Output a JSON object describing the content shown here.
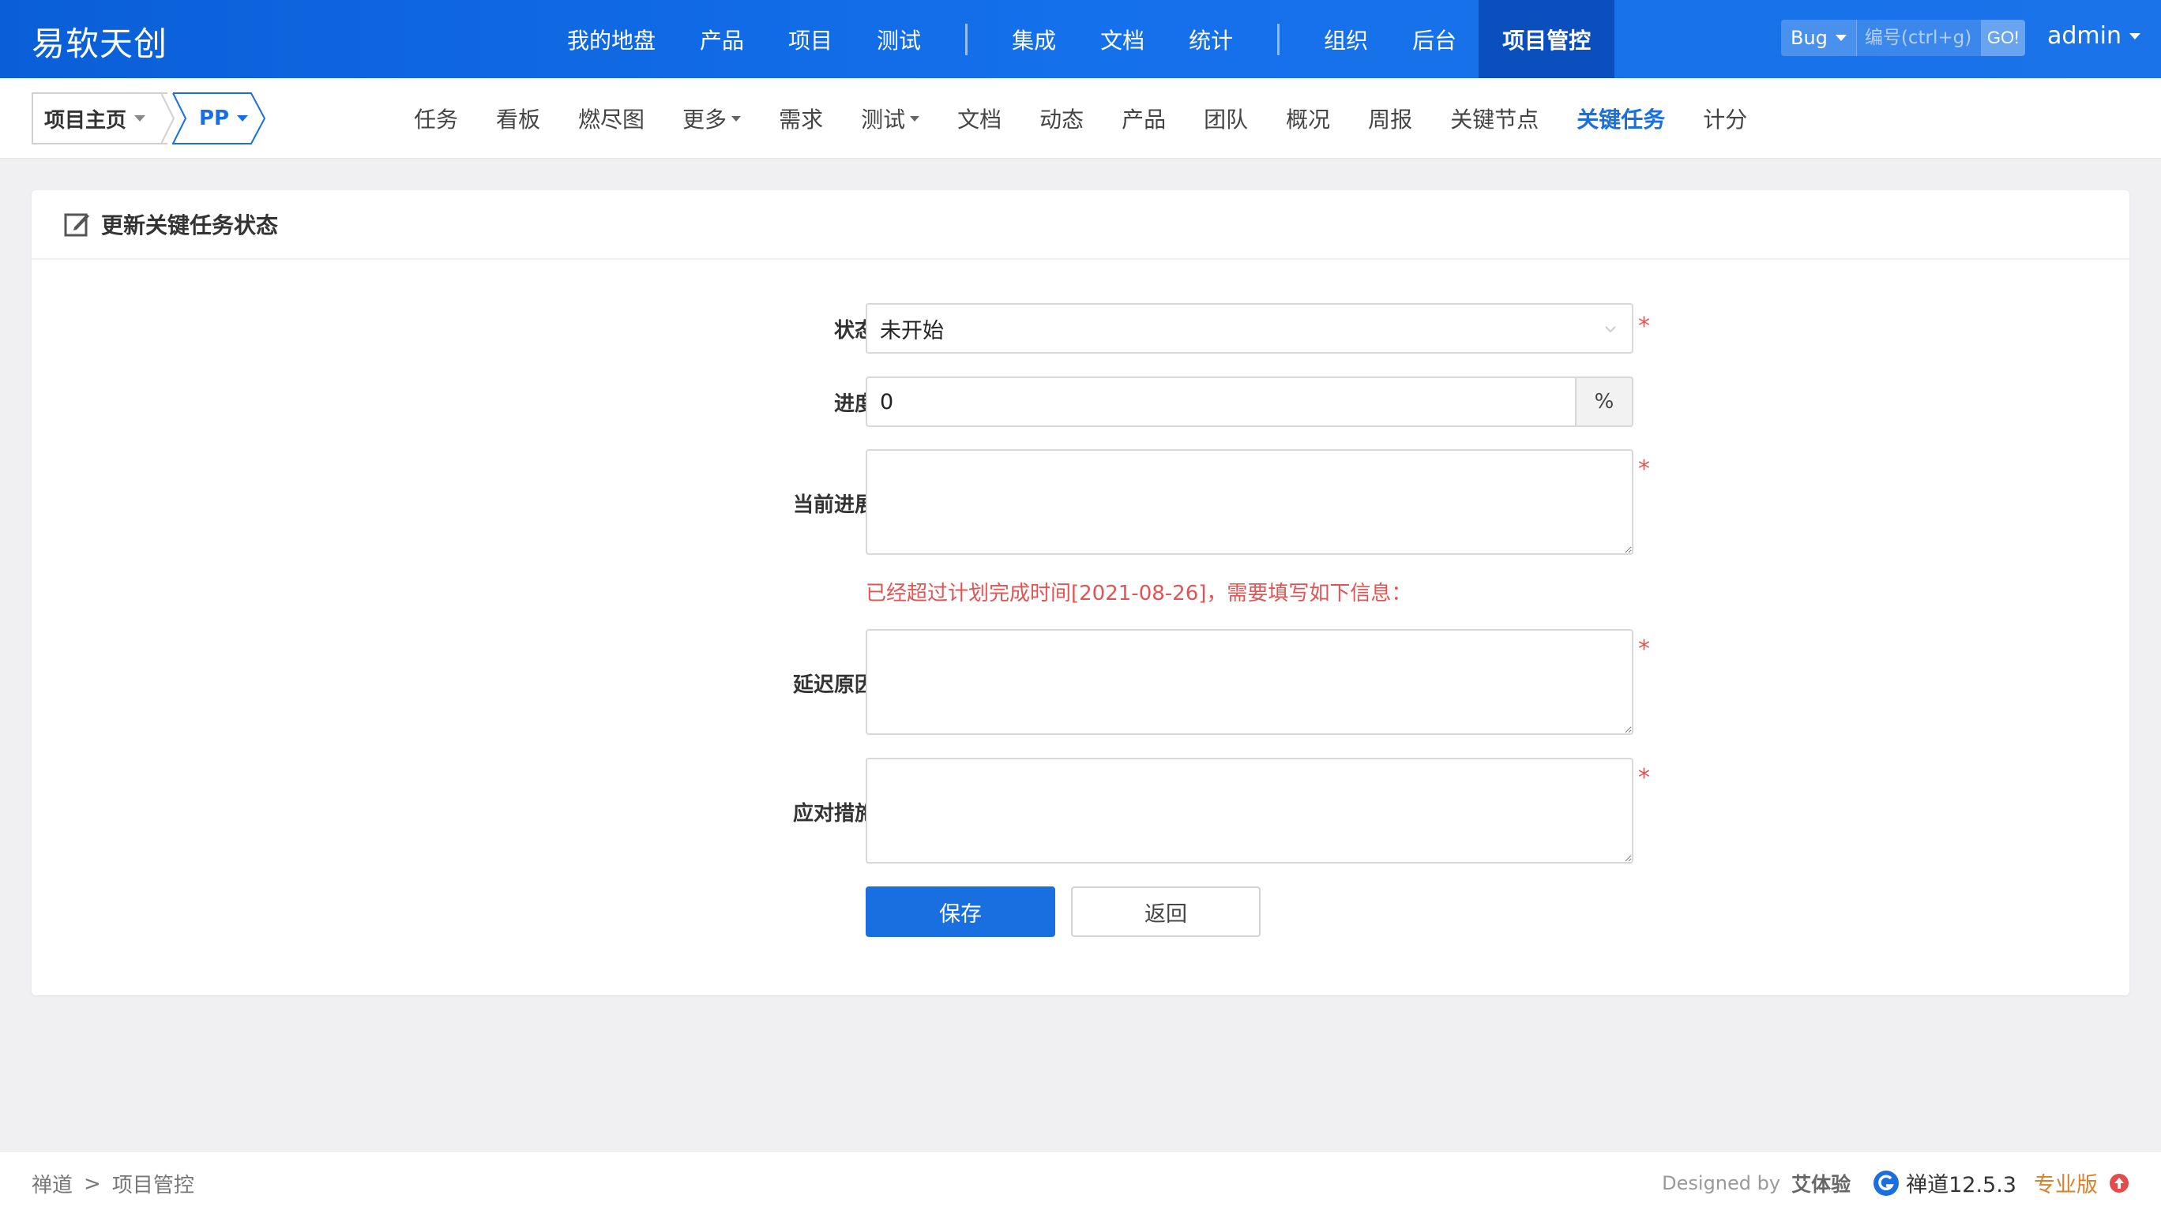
{
  "header": {
    "brand": "易软天创",
    "nav": [
      "我的地盘",
      "产品",
      "项目",
      "测试",
      "集成",
      "文档",
      "统计",
      "组织",
      "后台",
      "项目管控"
    ],
    "active_nav": "项目管控",
    "search_type": "Bug",
    "search_placeholder": "编号(ctrl+g)",
    "search_go": "GO!",
    "user": "admin"
  },
  "subbar": {
    "home": "项目主页",
    "project": "PP",
    "items": [
      "任务",
      "看板",
      "燃尽图",
      "更多",
      "需求",
      "测试",
      "文档",
      "动态",
      "产品",
      "团队",
      "概况",
      "周报",
      "关键节点",
      "关键任务",
      "计分"
    ],
    "active": "关键任务"
  },
  "form": {
    "title": "更新关键任务状态",
    "status_label": "状态",
    "status_value": "未开始",
    "progress_label": "进度",
    "progress_value": "0",
    "progress_unit": "%",
    "current_label": "当前进展",
    "warning": "已经超过计划完成时间[2021-08-26]，需要填写如下信息：",
    "delay_label": "延迟原因",
    "measure_label": "应对措施",
    "required_mark": "*",
    "save": "保存",
    "back": "返回"
  },
  "footer": {
    "crumb_root": "禅道",
    "crumb_sep": ">",
    "crumb_current": "项目管控",
    "designed_by": "Designed by",
    "designer": "艾体验",
    "version": "禅道12.5.3",
    "edition": "专业版"
  },
  "colors": {
    "primary": "#1a6fe0",
    "header_bg": "#1570ec",
    "required": "#e25454",
    "edition": "#d9822b"
  }
}
